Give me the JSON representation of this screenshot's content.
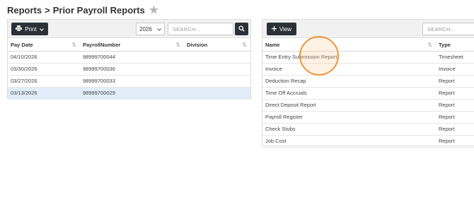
{
  "breadcrumb": {
    "root": "Reports",
    "separator": ">",
    "current": "Prior Payroll Reports"
  },
  "left_panel": {
    "print_label": "Print",
    "year_value": "2026",
    "search_placeholder": "SEARCH...",
    "columns": [
      "Pay Date",
      "PayrollNumber",
      "Division"
    ],
    "rows": [
      {
        "pay_date": "04/10/2026",
        "payroll_number": "98999700044",
        "division": ""
      },
      {
        "pay_date": "03/30/2026",
        "payroll_number": "98999700036",
        "division": ""
      },
      {
        "pay_date": "03/27/2026",
        "payroll_number": "98999700033",
        "division": ""
      },
      {
        "pay_date": "03/13/2026",
        "payroll_number": "98999700029",
        "division": ""
      }
    ]
  },
  "right_panel": {
    "view_label": "View",
    "search_placeholder": "SEARCH...",
    "columns": [
      "Name",
      "Type"
    ],
    "rows": [
      {
        "name": "Time Entry Submission Report",
        "type": "Timesheet"
      },
      {
        "name": "Invoice",
        "type": "Invoice"
      },
      {
        "name": "Deduction Recap",
        "type": "Report"
      },
      {
        "name": "Time Off Accruals",
        "type": "Report"
      },
      {
        "name": "Direct Deposit Report",
        "type": "Report"
      },
      {
        "name": "Payroll Register",
        "type": "Report"
      },
      {
        "name": "Check Stubs",
        "type": "Report"
      },
      {
        "name": "Job Cost",
        "type": "Report"
      }
    ]
  },
  "colors": {
    "dark_button": "#2b3136",
    "selected_row": "#e1edf9",
    "click_indicator": "#f0943a"
  }
}
